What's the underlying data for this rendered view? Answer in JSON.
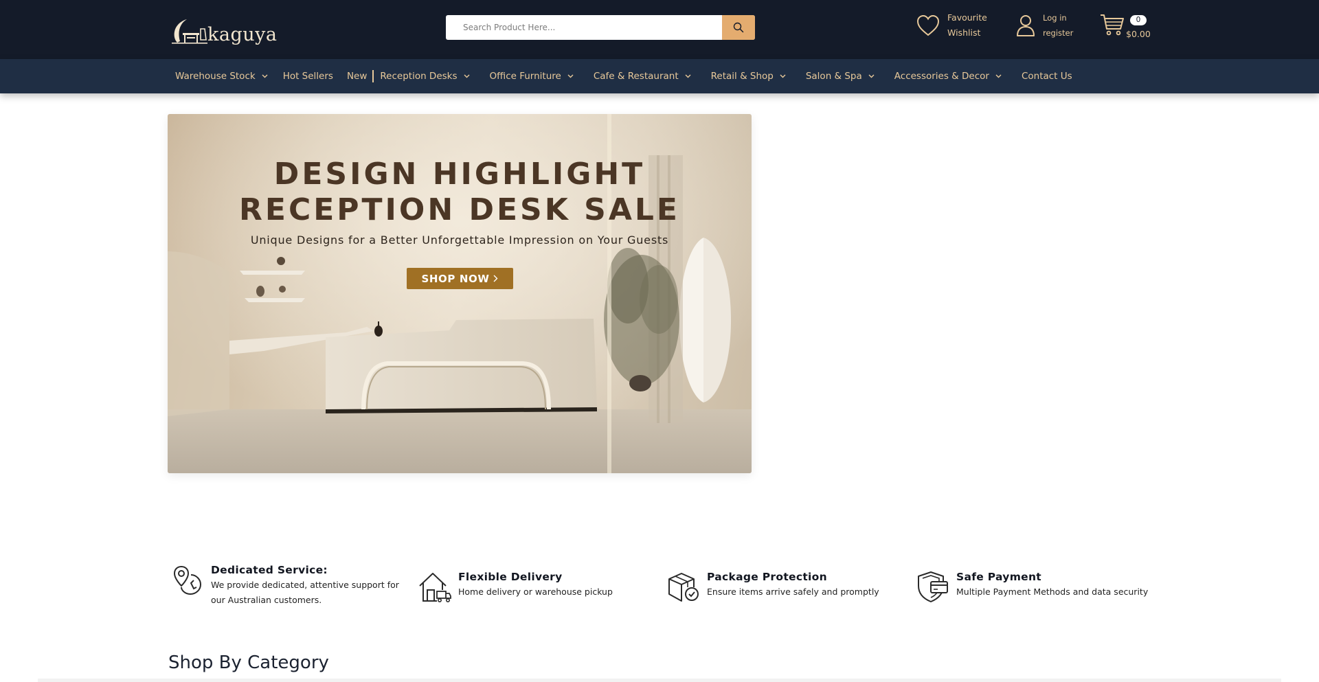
{
  "header": {
    "logo_text": "kaguya",
    "search": {
      "placeholder": "Search Product Here..."
    },
    "wishlist": {
      "line1": "Favourite",
      "line2": "Wishlist"
    },
    "account": {
      "line1": "Log in",
      "line2": "register"
    },
    "cart": {
      "count": "0",
      "total": "$0.00"
    }
  },
  "nav": {
    "items": [
      {
        "label": "Warehouse Stock"
      },
      {
        "label": "Hot Sellers"
      },
      {
        "label": "New"
      },
      {
        "label": "Reception Desks"
      },
      {
        "label": "Office Furniture"
      },
      {
        "label": "Cafe & Restaurant"
      },
      {
        "label": "Retail & Shop"
      },
      {
        "label": "Salon & Spa"
      },
      {
        "label": "Accessories & Decor"
      },
      {
        "label": "Contact Us"
      }
    ]
  },
  "hero": {
    "title_line1": "DESIGN HIGHLIGHT",
    "title_line2": "RECEPTION DESK SALE",
    "subtitle": "Unique Designs for a Better Unforgettable  Impression on Your Guests",
    "button": "SHOP NOW"
  },
  "features": [
    {
      "title": "Dedicated Service:",
      "desc": "We provide dedicated, attentive support for our Australian customers.",
      "icon": "location-service-icon"
    },
    {
      "title": "Flexible Delivery",
      "desc": "Home delivery or warehouse pickup",
      "icon": "home-delivery-icon"
    },
    {
      "title": "Package Protection",
      "desc": "Ensure items arrive safely and promptly",
      "icon": "package-check-icon"
    },
    {
      "title": "Safe Payment",
      "desc": "Multiple Payment Methods and data security",
      "icon": "shield-card-icon"
    }
  ],
  "sections": {
    "shop_by_category": "Shop By Category"
  },
  "colors": {
    "header_bg": "#141b29",
    "nav_bg": "#1f2e44",
    "accent": "#e4ac6f",
    "nav_text": "#e8c99a",
    "hero_button": "#a07024",
    "hero_title": "#4b3625"
  }
}
